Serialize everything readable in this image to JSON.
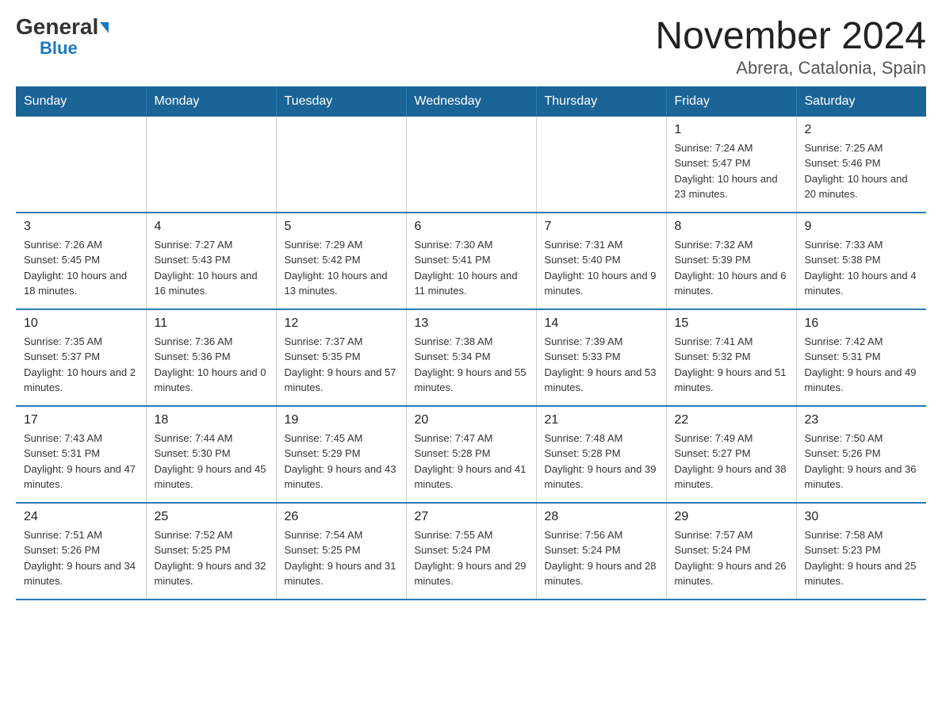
{
  "logo": {
    "general": "General",
    "blue": "Blue"
  },
  "title": "November 2024",
  "subtitle": "Abrera, Catalonia, Spain",
  "weekdays": [
    "Sunday",
    "Monday",
    "Tuesday",
    "Wednesday",
    "Thursday",
    "Friday",
    "Saturday"
  ],
  "weeks": [
    [
      {
        "day": "",
        "info": ""
      },
      {
        "day": "",
        "info": ""
      },
      {
        "day": "",
        "info": ""
      },
      {
        "day": "",
        "info": ""
      },
      {
        "day": "",
        "info": ""
      },
      {
        "day": "1",
        "info": "Sunrise: 7:24 AM\nSunset: 5:47 PM\nDaylight: 10 hours and 23 minutes."
      },
      {
        "day": "2",
        "info": "Sunrise: 7:25 AM\nSunset: 5:46 PM\nDaylight: 10 hours and 20 minutes."
      }
    ],
    [
      {
        "day": "3",
        "info": "Sunrise: 7:26 AM\nSunset: 5:45 PM\nDaylight: 10 hours and 18 minutes."
      },
      {
        "day": "4",
        "info": "Sunrise: 7:27 AM\nSunset: 5:43 PM\nDaylight: 10 hours and 16 minutes."
      },
      {
        "day": "5",
        "info": "Sunrise: 7:29 AM\nSunset: 5:42 PM\nDaylight: 10 hours and 13 minutes."
      },
      {
        "day": "6",
        "info": "Sunrise: 7:30 AM\nSunset: 5:41 PM\nDaylight: 10 hours and 11 minutes."
      },
      {
        "day": "7",
        "info": "Sunrise: 7:31 AM\nSunset: 5:40 PM\nDaylight: 10 hours and 9 minutes."
      },
      {
        "day": "8",
        "info": "Sunrise: 7:32 AM\nSunset: 5:39 PM\nDaylight: 10 hours and 6 minutes."
      },
      {
        "day": "9",
        "info": "Sunrise: 7:33 AM\nSunset: 5:38 PM\nDaylight: 10 hours and 4 minutes."
      }
    ],
    [
      {
        "day": "10",
        "info": "Sunrise: 7:35 AM\nSunset: 5:37 PM\nDaylight: 10 hours and 2 minutes."
      },
      {
        "day": "11",
        "info": "Sunrise: 7:36 AM\nSunset: 5:36 PM\nDaylight: 10 hours and 0 minutes."
      },
      {
        "day": "12",
        "info": "Sunrise: 7:37 AM\nSunset: 5:35 PM\nDaylight: 9 hours and 57 minutes."
      },
      {
        "day": "13",
        "info": "Sunrise: 7:38 AM\nSunset: 5:34 PM\nDaylight: 9 hours and 55 minutes."
      },
      {
        "day": "14",
        "info": "Sunrise: 7:39 AM\nSunset: 5:33 PM\nDaylight: 9 hours and 53 minutes."
      },
      {
        "day": "15",
        "info": "Sunrise: 7:41 AM\nSunset: 5:32 PM\nDaylight: 9 hours and 51 minutes."
      },
      {
        "day": "16",
        "info": "Sunrise: 7:42 AM\nSunset: 5:31 PM\nDaylight: 9 hours and 49 minutes."
      }
    ],
    [
      {
        "day": "17",
        "info": "Sunrise: 7:43 AM\nSunset: 5:31 PM\nDaylight: 9 hours and 47 minutes."
      },
      {
        "day": "18",
        "info": "Sunrise: 7:44 AM\nSunset: 5:30 PM\nDaylight: 9 hours and 45 minutes."
      },
      {
        "day": "19",
        "info": "Sunrise: 7:45 AM\nSunset: 5:29 PM\nDaylight: 9 hours and 43 minutes."
      },
      {
        "day": "20",
        "info": "Sunrise: 7:47 AM\nSunset: 5:28 PM\nDaylight: 9 hours and 41 minutes."
      },
      {
        "day": "21",
        "info": "Sunrise: 7:48 AM\nSunset: 5:28 PM\nDaylight: 9 hours and 39 minutes."
      },
      {
        "day": "22",
        "info": "Sunrise: 7:49 AM\nSunset: 5:27 PM\nDaylight: 9 hours and 38 minutes."
      },
      {
        "day": "23",
        "info": "Sunrise: 7:50 AM\nSunset: 5:26 PM\nDaylight: 9 hours and 36 minutes."
      }
    ],
    [
      {
        "day": "24",
        "info": "Sunrise: 7:51 AM\nSunset: 5:26 PM\nDaylight: 9 hours and 34 minutes."
      },
      {
        "day": "25",
        "info": "Sunrise: 7:52 AM\nSunset: 5:25 PM\nDaylight: 9 hours and 32 minutes."
      },
      {
        "day": "26",
        "info": "Sunrise: 7:54 AM\nSunset: 5:25 PM\nDaylight: 9 hours and 31 minutes."
      },
      {
        "day": "27",
        "info": "Sunrise: 7:55 AM\nSunset: 5:24 PM\nDaylight: 9 hours and 29 minutes."
      },
      {
        "day": "28",
        "info": "Sunrise: 7:56 AM\nSunset: 5:24 PM\nDaylight: 9 hours and 28 minutes."
      },
      {
        "day": "29",
        "info": "Sunrise: 7:57 AM\nSunset: 5:24 PM\nDaylight: 9 hours and 26 minutes."
      },
      {
        "day": "30",
        "info": "Sunrise: 7:58 AM\nSunset: 5:23 PM\nDaylight: 9 hours and 25 minutes."
      }
    ]
  ]
}
